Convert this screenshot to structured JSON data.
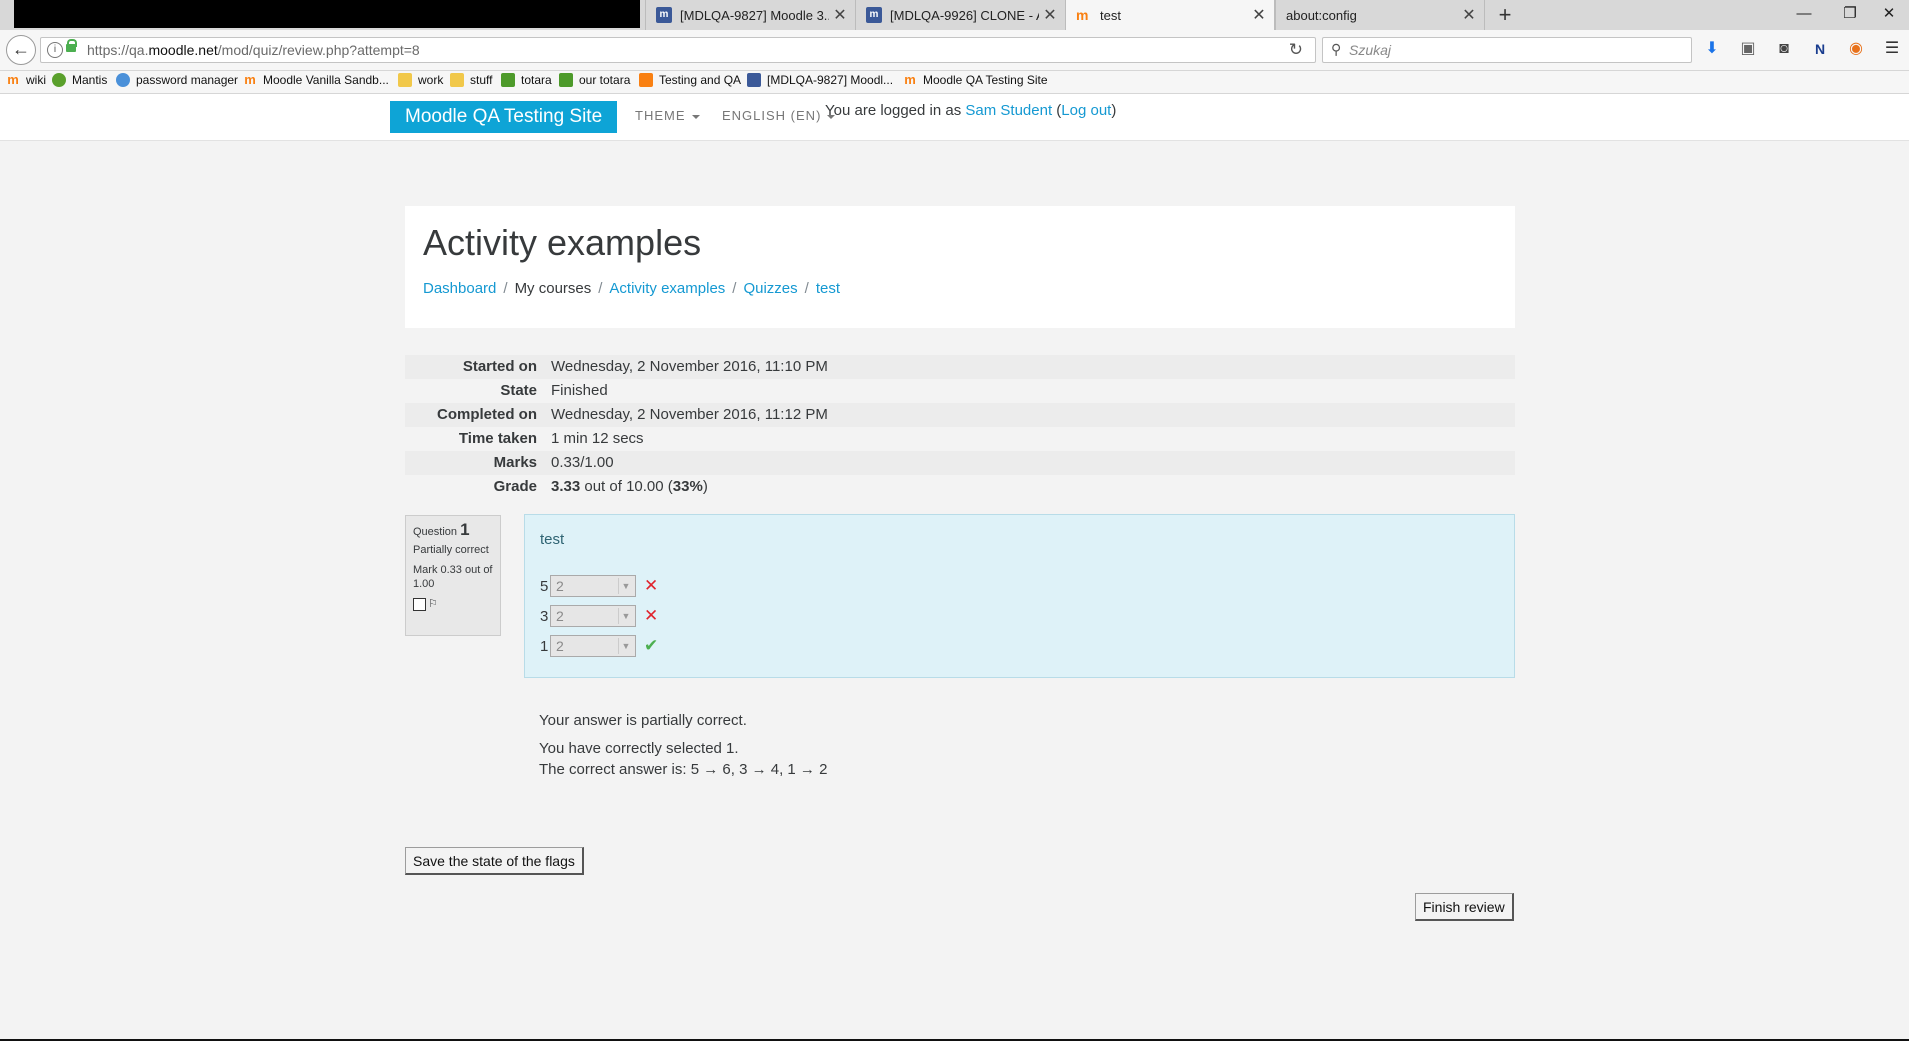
{
  "browser": {
    "tabs": [
      {
        "label": "[MDLQA-9827] Moodle 3....",
        "icon": "moodle-tracker-icon"
      },
      {
        "label": "[MDLQA-9926] CLONE - A...",
        "icon": "moodle-tracker-icon"
      },
      {
        "label": "test",
        "icon": "moodle-icon",
        "active": true
      },
      {
        "label": "about:config",
        "icon": ""
      }
    ],
    "url_prefix": "https://qa.",
    "url_host": "moodle.net",
    "url_path": "/mod/quiz/review.php?attempt=8",
    "search_placeholder": "Szukaj"
  },
  "bookmarks": [
    {
      "label": "wiki",
      "icon": "moodle"
    },
    {
      "label": "Mantis",
      "icon": "mantis"
    },
    {
      "label": "password manager",
      "icon": "pm"
    },
    {
      "label": "Moodle Vanilla Sandb...",
      "icon": "moodle"
    },
    {
      "label": "work",
      "icon": "folder"
    },
    {
      "label": "stuff",
      "icon": "folder"
    },
    {
      "label": "totara",
      "icon": "green"
    },
    {
      "label": "our totara",
      "icon": "green"
    },
    {
      "label": "Testing and QA",
      "icon": "orange"
    },
    {
      "label": "[MDLQA-9827] Moodl...",
      "icon": "blue"
    },
    {
      "label": "Moodle QA Testing Site",
      "icon": "moodle"
    }
  ],
  "site": {
    "brand": "Moodle QA Testing Site",
    "theme_menu": "THEME",
    "language_menu": "ENGLISH (EN)",
    "login_prefix": "You are logged in as ",
    "user_name": "Sam Student",
    "logout": "Log out"
  },
  "page": {
    "title": "Activity examples",
    "breadcrumbs": [
      "Dashboard",
      "My courses",
      "Activity examples",
      "Quizzes",
      "test"
    ]
  },
  "summary": [
    {
      "label": "Started on",
      "value": "Wednesday, 2 November 2016, 11:10 PM"
    },
    {
      "label": "State",
      "value": "Finished"
    },
    {
      "label": "Completed on",
      "value": "Wednesday, 2 November 2016, 11:12 PM"
    },
    {
      "label": "Time taken",
      "value": "1 min 12 secs"
    },
    {
      "label": "Marks",
      "value": "0.33/1.00"
    }
  ],
  "grade": {
    "label": "Grade",
    "score": "3.33",
    "middle": " out of 10.00 (",
    "percent": "33%",
    "end": ")"
  },
  "question": {
    "word": "Question",
    "number": "1",
    "status": "Partially correct",
    "mark": "Mark 0.33 out of 1.00",
    "text": "test",
    "rows": [
      {
        "num": "5",
        "selected": "2",
        "correct": false
      },
      {
        "num": "3",
        "selected": "2",
        "correct": false
      },
      {
        "num": "1",
        "selected": "2",
        "correct": true
      }
    ]
  },
  "feedback": {
    "overall": "Your answer is partially correct.",
    "selected": "You have correctly selected 1.",
    "correct_answer": "The correct answer is: 5 → 6, 3 → 4, 1 → 2"
  },
  "buttons": {
    "save_flags": "Save the state of the flags",
    "finish_review": "Finish review"
  }
}
